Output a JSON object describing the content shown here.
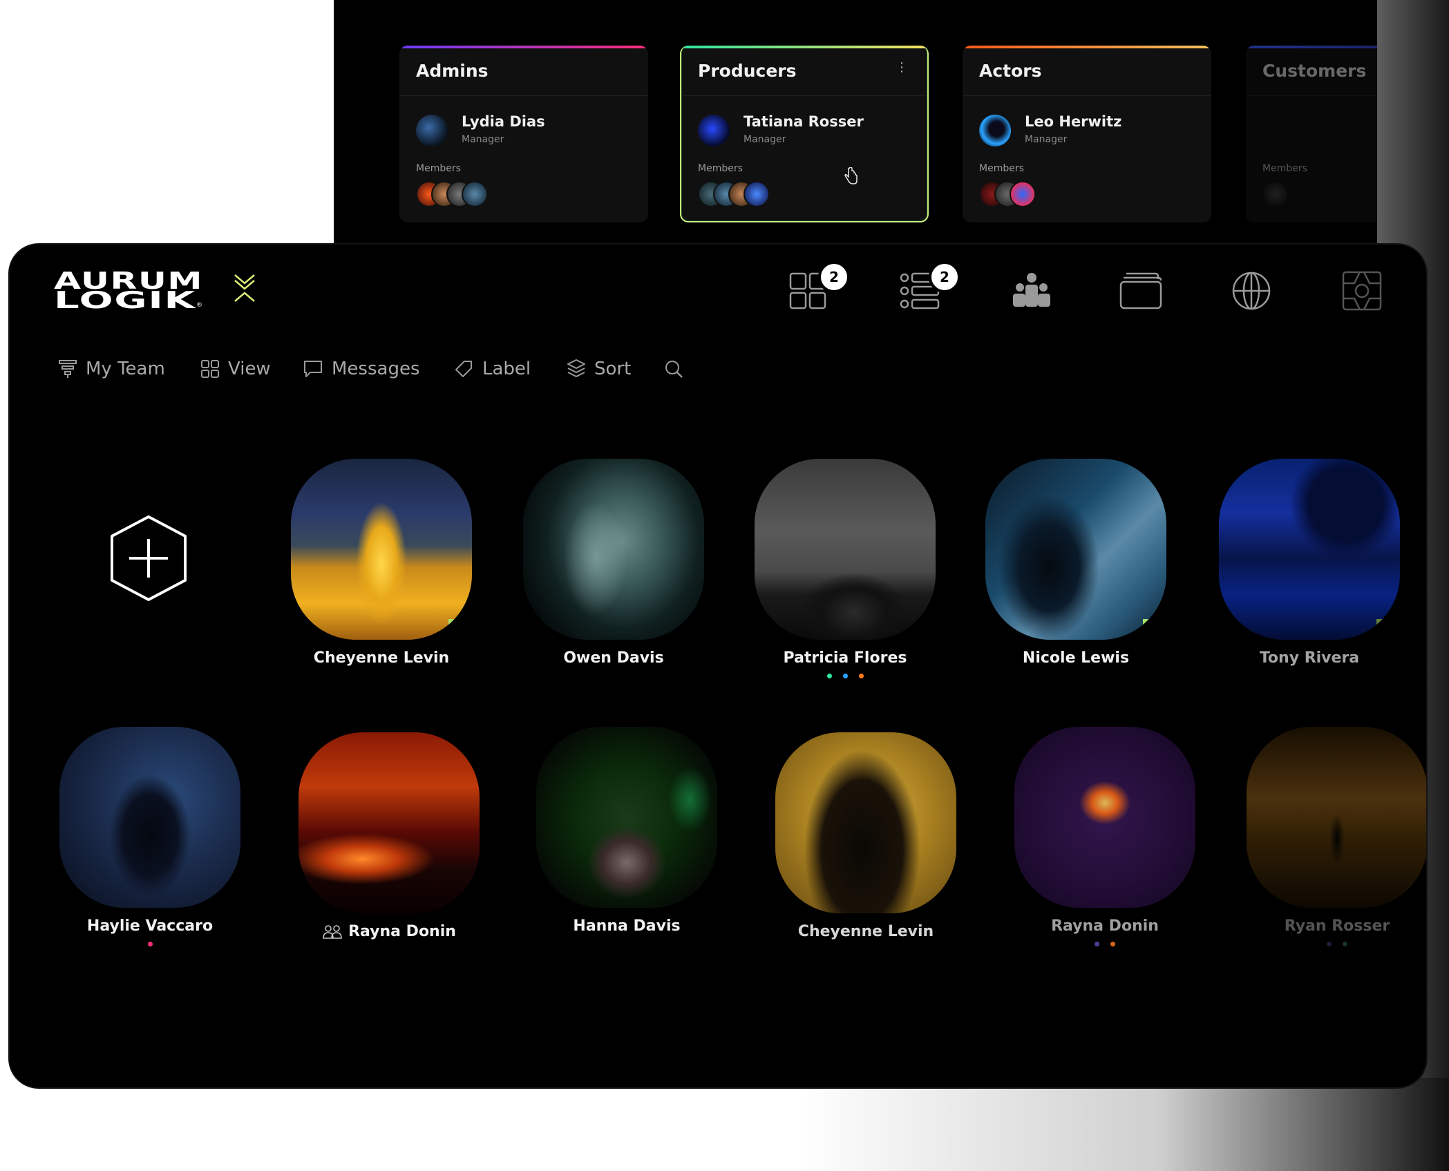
{
  "teams": [
    {
      "title": "Admins",
      "manager_name": "Lydia Dias",
      "manager_role": "Manager",
      "members_label": "Members",
      "accent": "#8a3cff"
    },
    {
      "title": "Producers",
      "manager_name": "Tatiana Rosser",
      "manager_role": "Manager",
      "members_label": "Members",
      "accent": "#c9f07a"
    },
    {
      "title": "Actors",
      "manager_name": "Leo Herwitz",
      "manager_role": "Manager",
      "members_label": "Members",
      "accent": "#ff7a1a"
    },
    {
      "title": "Customers",
      "members_label": "Members",
      "accent": "#3b5cff"
    }
  ],
  "brand": {
    "logo_line1": "AURUM",
    "logo_line2": "LOGIK",
    "accent": "#d9ef7a"
  },
  "top_nav": [
    {
      "icon": "grid-icon",
      "badge": "2"
    },
    {
      "icon": "list-icon",
      "badge": "2"
    },
    {
      "icon": "team-icon"
    },
    {
      "icon": "folder-icon"
    },
    {
      "icon": "globe-icon"
    },
    {
      "icon": "gallery-icon"
    }
  ],
  "toolbar": {
    "my_team": "My Team",
    "view": "View",
    "messages": "Messages",
    "label": "Label",
    "sort": "Sort"
  },
  "people_row1": [
    {
      "name": "Cheyenne Levin",
      "tag": true
    },
    {
      "name": "Owen Davis"
    },
    {
      "name": "Patricia Flores",
      "dots": [
        "#2ee6a0",
        "#2aa4ff",
        "#ff7a1a"
      ]
    },
    {
      "name": "Nicole Lewis",
      "tag": true
    },
    {
      "name": "Tony Rivera",
      "tag": true
    }
  ],
  "people_row2": [
    {
      "name": "Haylie Vaccaro",
      "dots": [
        "#ff2d7a"
      ]
    },
    {
      "name": "Rayna Donin",
      "co_owner_icon": true
    },
    {
      "name": "Hanna Davis"
    },
    {
      "name": "Cheyenne Levin"
    },
    {
      "name": "Rayna Donin",
      "dots": [
        "#5a4ab8",
        "#ff7a1a"
      ]
    },
    {
      "name": "Ryan Rosser",
      "dots": [
        "#3a3a6a",
        "#2a5a5a"
      ]
    }
  ]
}
